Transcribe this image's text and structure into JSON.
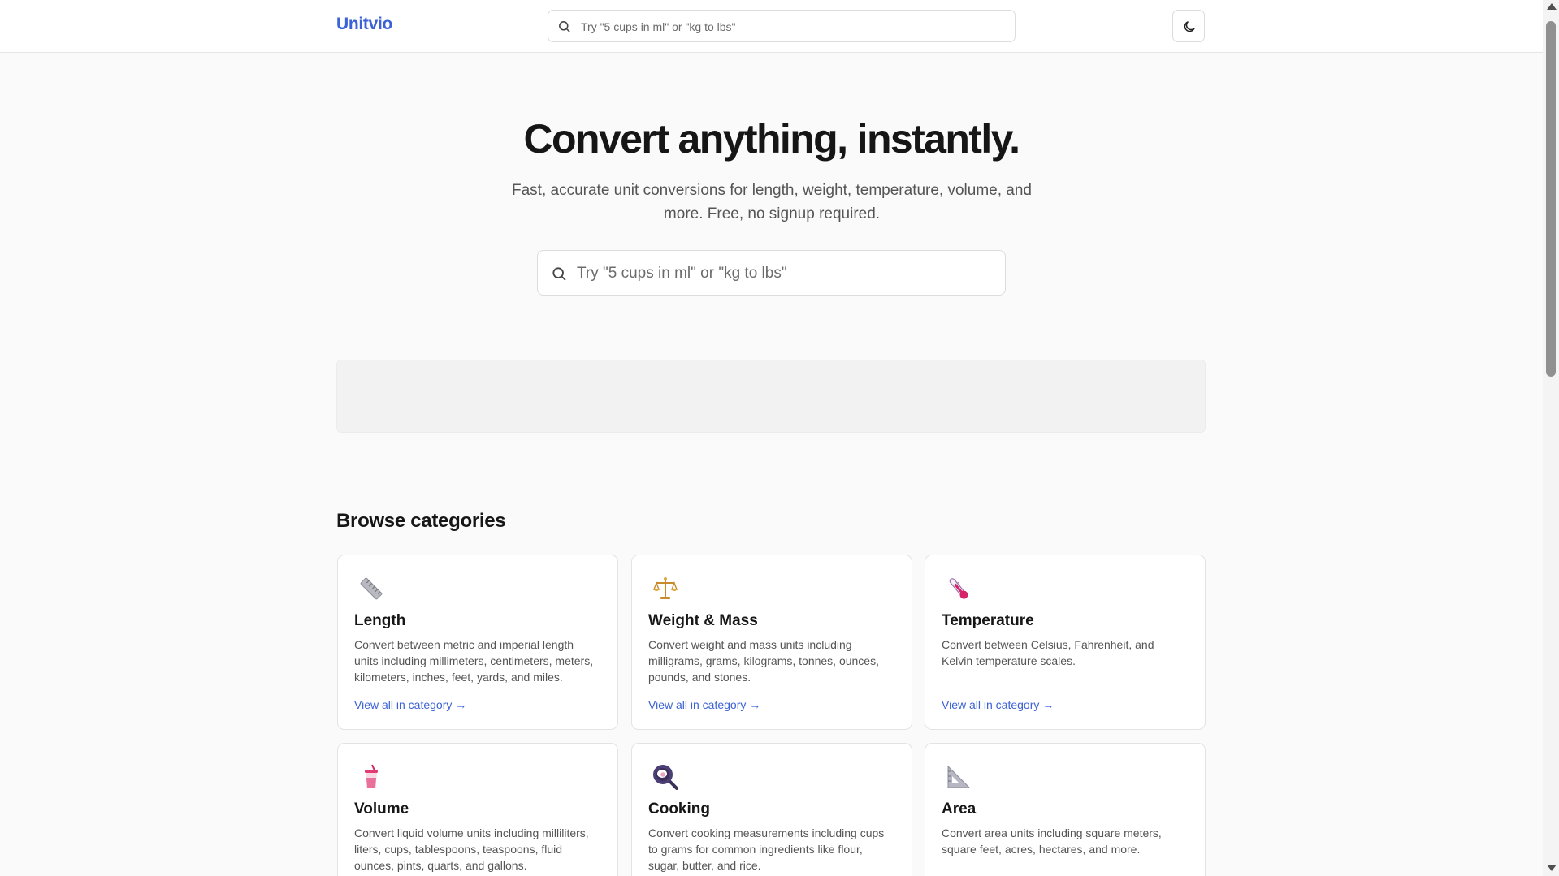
{
  "header": {
    "logo": "Unitvio",
    "search_placeholder": "Try \"5 cups in ml\" or \"kg to lbs\"",
    "theme_icon": "moon-icon"
  },
  "hero": {
    "title": "Convert anything, instantly.",
    "subtitle": "Fast, accurate unit conversions for length, weight, temperature, volume, and more. Free, no signup required.",
    "search_placeholder": "Try \"5 cups in ml\" or \"kg to lbs\""
  },
  "categories": {
    "title": "Browse categories",
    "link_label": "View all in category →",
    "items": [
      {
        "icon": "ruler-icon",
        "title": "Length",
        "description": "Convert between metric and imperial length units including millimeters, centimeters, meters, kilometers, inches, feet, yards, and miles."
      },
      {
        "icon": "scales-icon",
        "title": "Weight & Mass",
        "description": "Convert weight and mass units including milligrams, grams, kilograms, tonnes, ounces, pounds, and stones."
      },
      {
        "icon": "thermometer-icon",
        "title": "Temperature",
        "description": "Convert between Celsius, Fahrenheit, and Kelvin temperature scales."
      },
      {
        "icon": "cup-icon",
        "title": "Volume",
        "description": "Convert liquid volume units including milliliters, liters, cups, tablespoons, teaspoons, fluid ounces, pints, quarts, and gallons."
      },
      {
        "icon": "frying-pan-icon",
        "title": "Cooking",
        "description": "Convert cooking measurements including cups to grams for common ingredients like flour, sugar, butter, and rice."
      },
      {
        "icon": "triangle-ruler-icon",
        "title": "Area",
        "description": "Convert area units including square meters, square feet, acres, hectares, and more."
      }
    ]
  },
  "colors": {
    "accent": "#3b62d6",
    "background": "#fafafa",
    "card_border": "#e3e3e3"
  }
}
